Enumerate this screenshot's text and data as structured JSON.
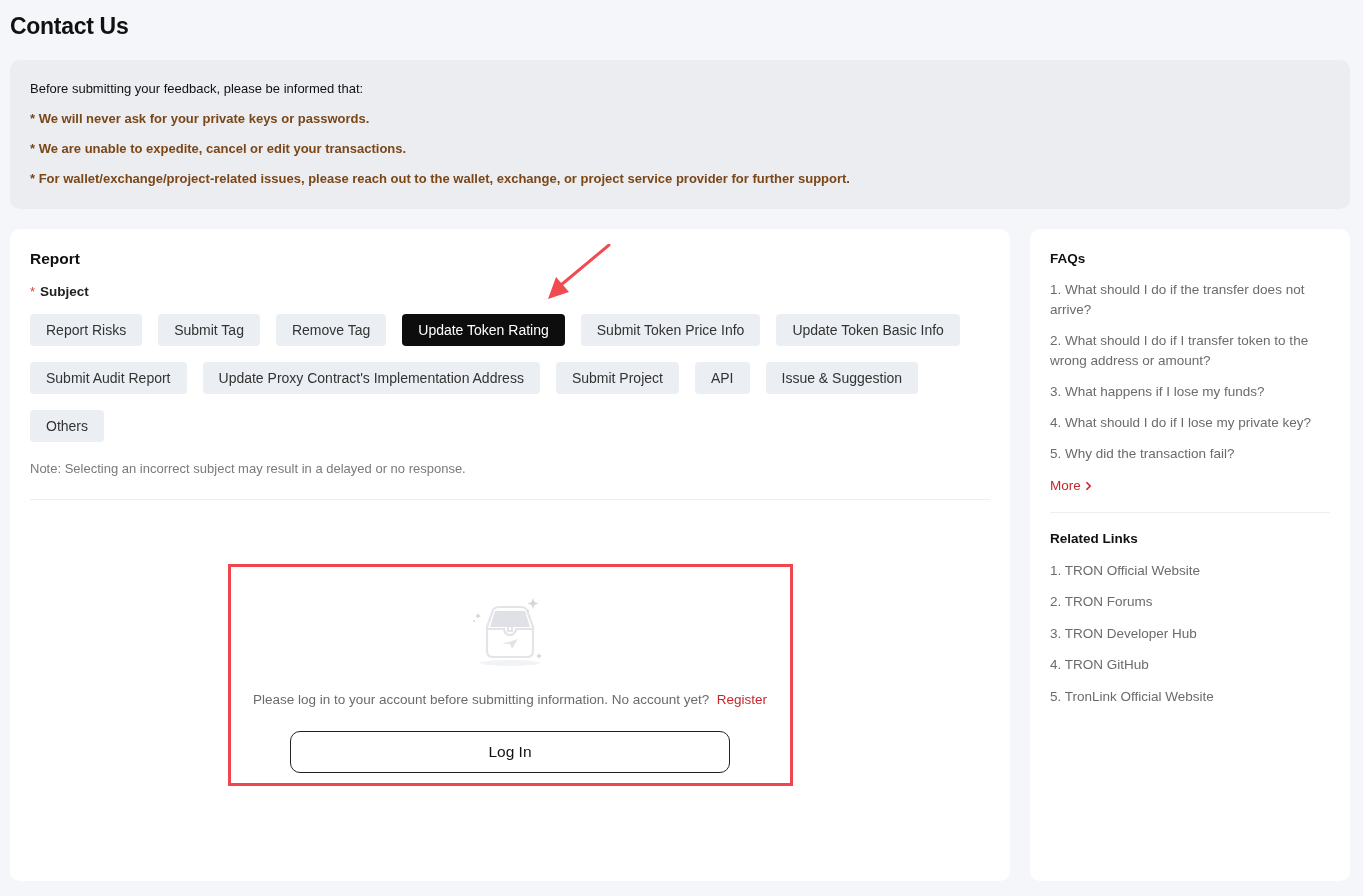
{
  "page": {
    "title": "Contact Us"
  },
  "notice": {
    "intro": "Before submitting your feedback, please be informed that:",
    "items": [
      "* We will never ask for your private keys or passwords.",
      "* We are unable to expedite, cancel or edit your transactions.",
      "* For wallet/exchange/project-related issues, please reach out to the wallet, exchange, or project service provider for further support."
    ]
  },
  "report": {
    "title": "Report",
    "required_mark": "*",
    "subject_label": "Subject",
    "subjects": [
      {
        "label": "Report Risks",
        "selected": false,
        "pointed_at": false
      },
      {
        "label": "Submit Tag",
        "selected": false,
        "pointed_at": false
      },
      {
        "label": "Remove Tag",
        "selected": false,
        "pointed_at": false
      },
      {
        "label": "Update Token Rating",
        "selected": true,
        "pointed_at": true
      },
      {
        "label": "Submit Token Price Info",
        "selected": false,
        "pointed_at": false
      },
      {
        "label": "Update Token Basic Info",
        "selected": false,
        "pointed_at": false
      },
      {
        "label": "Submit Audit Report",
        "selected": false,
        "pointed_at": false
      },
      {
        "label": "Update Proxy Contract's Implementation Address",
        "selected": false,
        "pointed_at": false
      },
      {
        "label": "Submit Project",
        "selected": false,
        "pointed_at": false
      },
      {
        "label": "API",
        "selected": false,
        "pointed_at": false
      },
      {
        "label": "Issue & Suggestion",
        "selected": false,
        "pointed_at": false
      },
      {
        "label": "Others",
        "selected": false,
        "pointed_at": false
      }
    ],
    "note": "Note: Selecting an incorrect subject may result in a delayed or no response."
  },
  "login": {
    "highlighted": true,
    "message": "Please log in to your account before submitting information. No account yet?",
    "register_link": "Register",
    "button": "Log In"
  },
  "sidebar": {
    "faqs": {
      "title": "FAQs",
      "items": [
        "1. What should I do if the transfer does not arrive?",
        "2. What should I do if I transfer token to the wrong address or amount?",
        "3. What happens if I lose my funds?",
        "4. What should I do if I lose my private key?",
        "5. Why did the transaction fail?"
      ],
      "more": "More"
    },
    "related_links": {
      "title": "Related Links",
      "items": [
        "1. TRON Official Website",
        "2. TRON Forums",
        "3. TRON Developer Hub",
        "4. TRON GitHub",
        "5. TronLink Official Website"
      ]
    }
  }
}
